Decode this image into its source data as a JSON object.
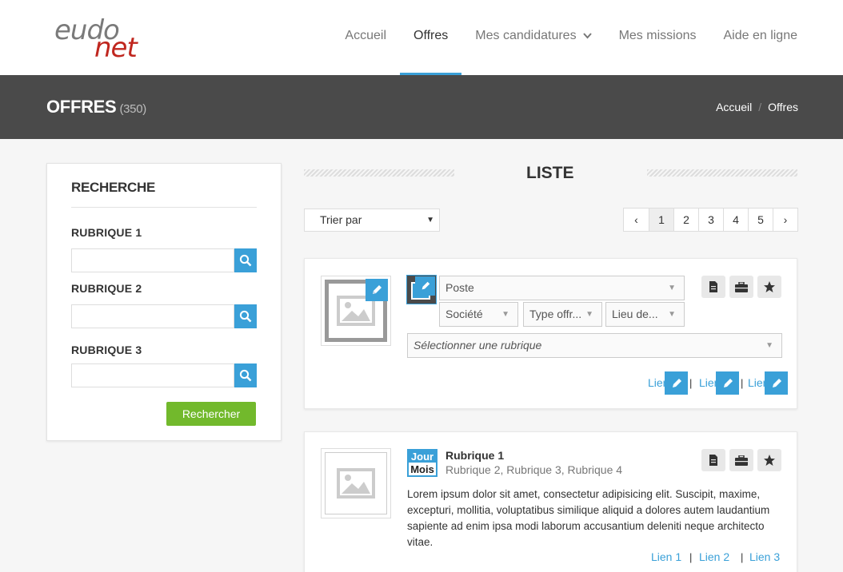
{
  "logo": {
    "part1": "eudo",
    "part2": "net"
  },
  "nav": {
    "items": [
      "Accueil",
      "Offres",
      "Mes candidatures",
      "Mes missions",
      "Aide en ligne"
    ],
    "active": "Offres"
  },
  "header": {
    "title": "OFFRES",
    "count": "(350)",
    "breadcrumb": [
      "Accueil",
      "Offres"
    ],
    "breadcrumb_sep": "/"
  },
  "search": {
    "title": "RECHERCHE",
    "fields": [
      {
        "label": "RUBRIQUE 1",
        "value": ""
      },
      {
        "label": "RUBRIQUE 2",
        "value": ""
      },
      {
        "label": "RUBRIQUE 3",
        "value": ""
      }
    ],
    "button": "Rechercher"
  },
  "list": {
    "title": "LISTE",
    "sort_label": "Trier par",
    "pager": [
      "‹",
      "1",
      "2",
      "3",
      "4",
      "5",
      "›"
    ],
    "current_page": "1"
  },
  "card_edit": {
    "selects": {
      "poste": "Poste",
      "societe": "Société",
      "type": "Type offr...",
      "lieu": "Lieu de...",
      "rubrique": "Sélectionner une rubrique"
    },
    "links": [
      "Lien",
      "Lien",
      "Lien"
    ],
    "link_sep": "|"
  },
  "card_view": {
    "date_top": "Jour",
    "date_bottom": "Mois",
    "rubrique1": "Rubrique 1",
    "rubriques": "Rubrique 2, Rubrique 3, Rubrique 4",
    "description": "Lorem ipsum dolor sit amet, consectetur adipisicing elit. Suscipit, maxime, excepturi, mollitia, voluptatibus similique aliquid a dolores autem laudantium sapiente ad enim ipsa modi laborum accusantium deleniti neque architecto vitae.",
    "links": [
      "Lien 1",
      "Lien 2",
      "Lien 3"
    ],
    "link_sep": "|"
  },
  "colors": {
    "accent": "#3aa0d8",
    "brand_red": "#c0271f",
    "button_green": "#72b92c",
    "band": "#4a4a4a"
  }
}
